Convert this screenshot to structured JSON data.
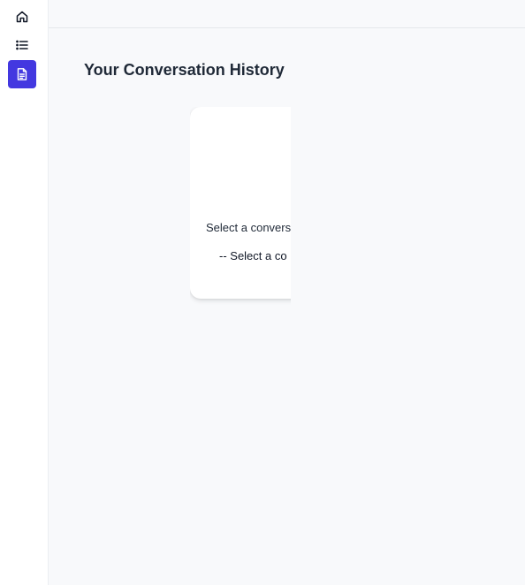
{
  "sidebar": {
    "items": [
      {
        "name": "home",
        "icon": "home-icon",
        "active": false
      },
      {
        "name": "list",
        "icon": "list-icon",
        "active": false
      },
      {
        "name": "document",
        "icon": "document-icon",
        "active": true
      }
    ],
    "active_color": "#4338e0"
  },
  "main": {
    "title": "Your Conversation History",
    "card": {
      "label": "Select a convers",
      "select_value": "-- Select a co"
    }
  }
}
